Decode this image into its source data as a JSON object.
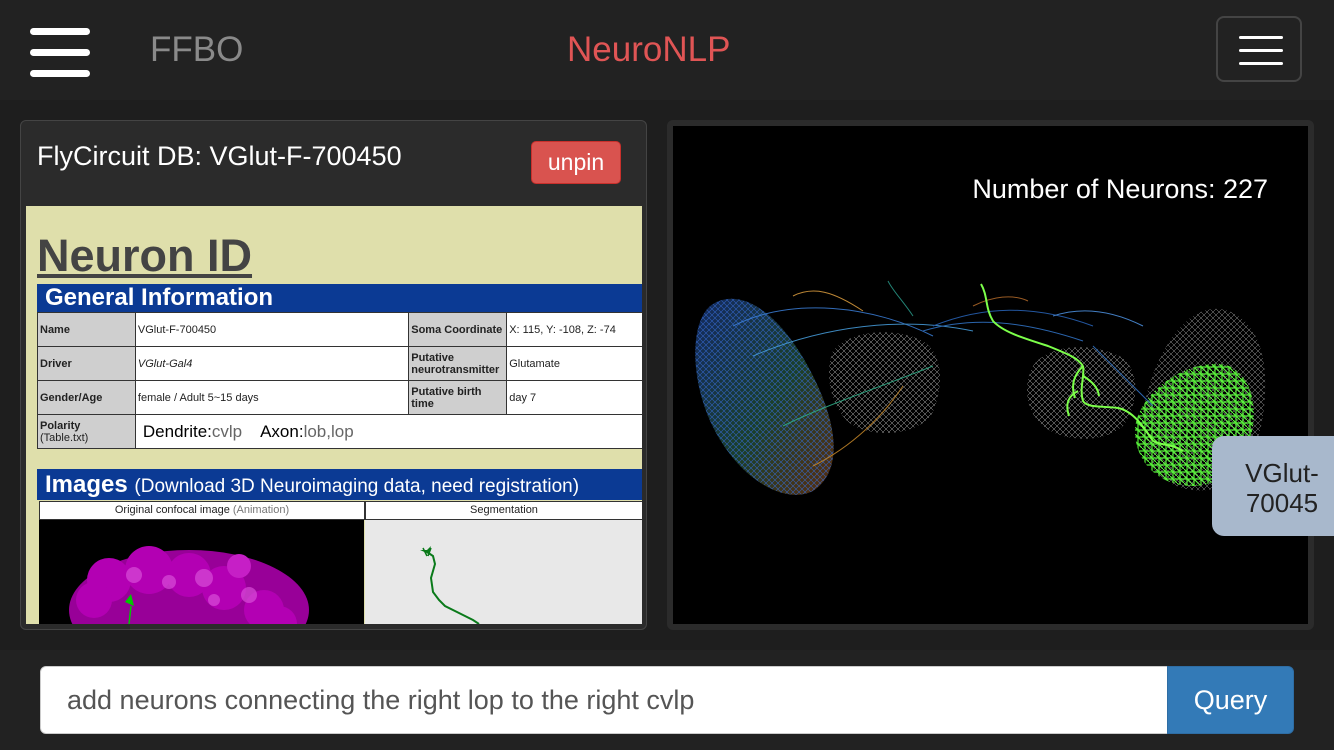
{
  "header": {
    "brand": "FFBO",
    "title": "NeuroNLP",
    "menu_icon": "hamburger-icon"
  },
  "info_panel": {
    "title": "FlyCircuit DB: VGlut-F-700450",
    "unpin_label": "unpin",
    "heading": "Neuron ID",
    "general_info_label": "General Information",
    "fields": {
      "name_label": "Name",
      "name_value": "VGlut-F-700450",
      "soma_label": "Soma Coordinate",
      "soma_value": "X: 115, Y: -108, Z: -74",
      "driver_label": "Driver",
      "driver_value": "VGlut-Gal4",
      "neurotransmitter_label": "Putative neurotransmitter",
      "neurotransmitter_value": "Glutamate",
      "gender_label": "Gender/Age",
      "gender_value": "female / Adult 5~15 days",
      "birth_label": "Putative birth time",
      "birth_value": "day 7",
      "polarity_label": "Polarity",
      "polarity_sub": "(Table.txt)",
      "dendrite_label": "Dendrite:",
      "dendrite_value": "cvlp",
      "axon_label": "Axon:",
      "axon_value": "lob,lop"
    },
    "images_label": "Images",
    "images_sub": "(Download 3D Neuroimaging data, need registration)",
    "confocal_label": "Original confocal image",
    "confocal_link": "(Animation)",
    "segmentation_label": "Segmentation"
  },
  "viewer": {
    "neuron_count_text": "Number of Neurons: 227",
    "tooltip_line1": "VGlut-",
    "tooltip_line2": "70045"
  },
  "query": {
    "input_value": "add neurons connecting the right lop to the right cvlp",
    "button_label": "Query"
  },
  "colors": {
    "header_bg": "#222222",
    "title_red": "#e05555",
    "unpin_red": "#d9534f",
    "section_blue": "#0b3a94",
    "doc_bg": "#dfdfab",
    "query_blue": "#337ab7",
    "highlight_green": "#7cff4a"
  }
}
